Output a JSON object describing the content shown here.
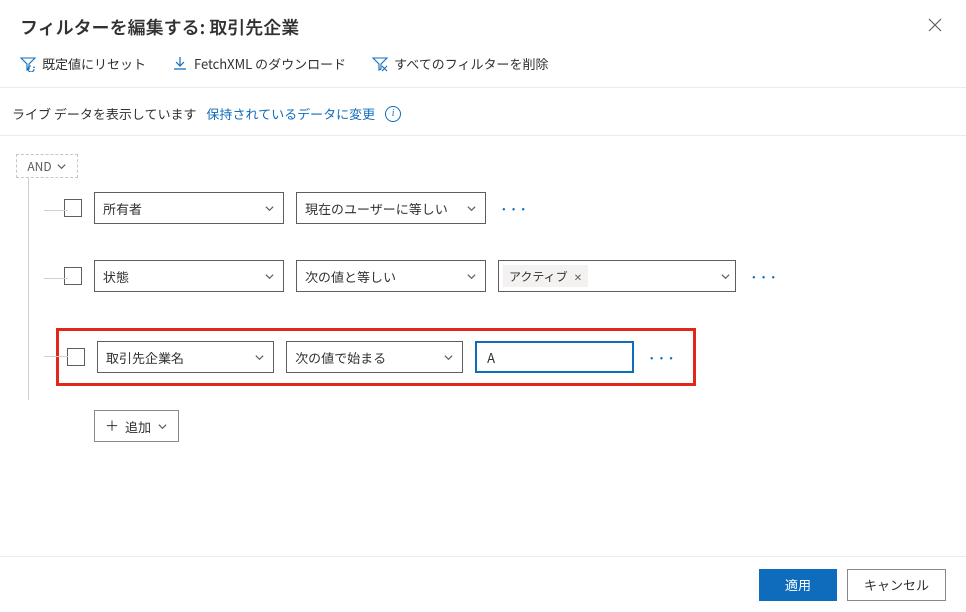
{
  "header": {
    "title": "フィルターを編集する: 取引先企業"
  },
  "commands": {
    "reset": "既定値にリセット",
    "download": "FetchXML のダウンロード",
    "clear": "すべてのフィルターを削除"
  },
  "infobar": {
    "live_text": "ライブ データを表示しています",
    "link_text": "保持されているデータに変更"
  },
  "group": {
    "operator": "AND"
  },
  "rows": [
    {
      "field": "所有者",
      "operator": "現在のユーザーに等しい",
      "value_type": "none"
    },
    {
      "field": "状態",
      "operator": "次の値と等しい",
      "value_type": "tag",
      "tag_value": "アクティブ"
    },
    {
      "field": "取引先企業名",
      "operator": "次の値で始まる",
      "value_type": "text",
      "text_value": "A",
      "highlight": true
    }
  ],
  "add_button": "追加",
  "footer": {
    "apply": "適用",
    "cancel": "キャンセル"
  }
}
